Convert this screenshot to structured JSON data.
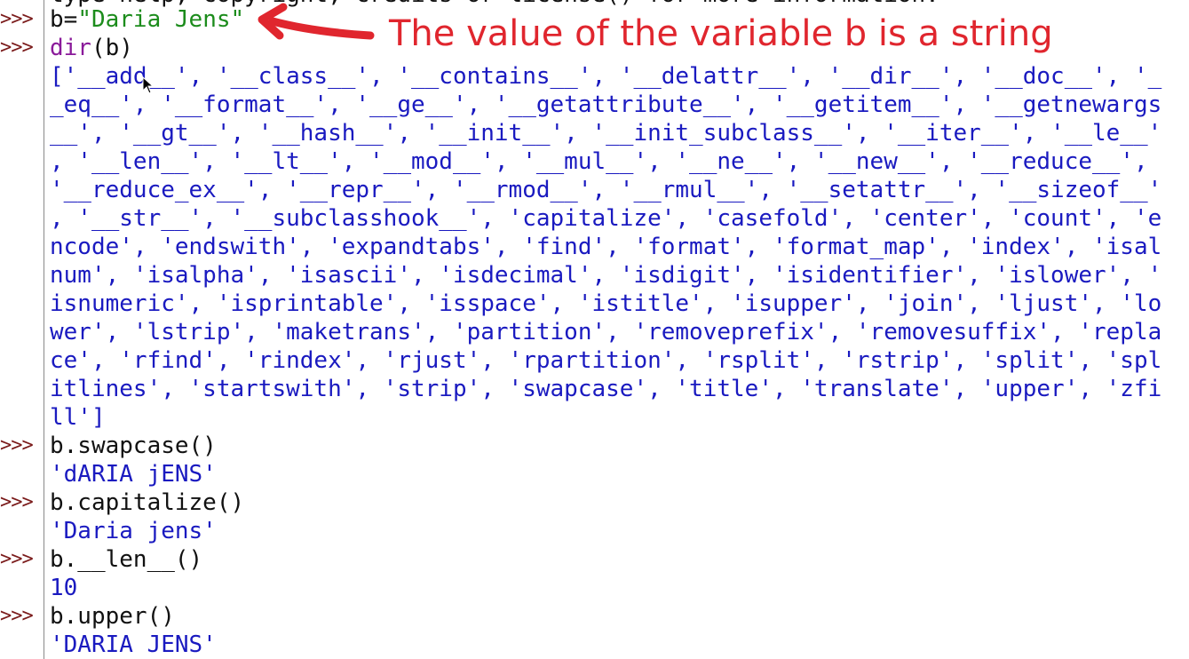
{
  "prompt_symbol": ">>>",
  "top_partial_line": "type help, copyright, credits or license() for more information.",
  "lines": [
    {
      "text": "",
      "segments": [
        {
          "cls": "code",
          "t": "b="
        },
        {
          "cls": "str",
          "t": "\"Daria Jens\""
        }
      ]
    },
    {
      "segments": [
        {
          "cls": "builtin",
          "t": "dir"
        },
        {
          "cls": "code",
          "t": "(b)"
        }
      ]
    }
  ],
  "dir_output": [
    "['__add__', '__class__', '__contains__', '__delattr__', '__dir__', '__doc__', '_",
    "_eq__', '__format__', '__ge__', '__getattribute__', '__getitem__', '__getnewargs",
    "__', '__gt__', '__hash__', '__init__', '__init_subclass__', '__iter__', '__le__'",
    ", '__len__', '__lt__', '__mod__', '__mul__', '__ne__', '__new__', '__reduce__',",
    "'__reduce_ex__', '__repr__', '__rmod__', '__rmul__', '__setattr__', '__sizeof__'",
    ", '__str__', '__subclasshook__', 'capitalize', 'casefold', 'center', 'count', 'e",
    "ncode', 'endswith', 'expandtabs', 'find', 'format', 'format_map', 'index', 'isal",
    "num', 'isalpha', 'isascii', 'isdecimal', 'isdigit', 'isidentifier', 'islower', '",
    "isnumeric', 'isprintable', 'isspace', 'istitle', 'isupper', 'join', 'ljust', 'lo",
    "wer', 'lstrip', 'maketrans', 'partition', 'removeprefix', 'removesuffix', 'repla",
    "ce', 'rfind', 'rindex', 'rjust', 'rpartition', 'rsplit', 'rstrip', 'split', 'spl",
    "itlines', 'startswith', 'strip', 'swapcase', 'title', 'translate', 'upper', 'zfi",
    "ll']"
  ],
  "commands": [
    {
      "input": "b.swapcase()",
      "output": "'dARIA jENS'"
    },
    {
      "input": "b.capitalize()",
      "output": "'Daria jens'"
    },
    {
      "input": "b.__len__()",
      "output": "10"
    },
    {
      "input": "b.upper()",
      "output": "'DARIA JENS'"
    }
  ],
  "annotation": {
    "text": "The value of the variable b is a string",
    "color": "#e0262e"
  },
  "colors": {
    "prompt": "#7a1a1a",
    "code": "#111111",
    "builtin": "#8a1a9a",
    "string": "#1c8c1c",
    "output": "#1a1ac0"
  }
}
